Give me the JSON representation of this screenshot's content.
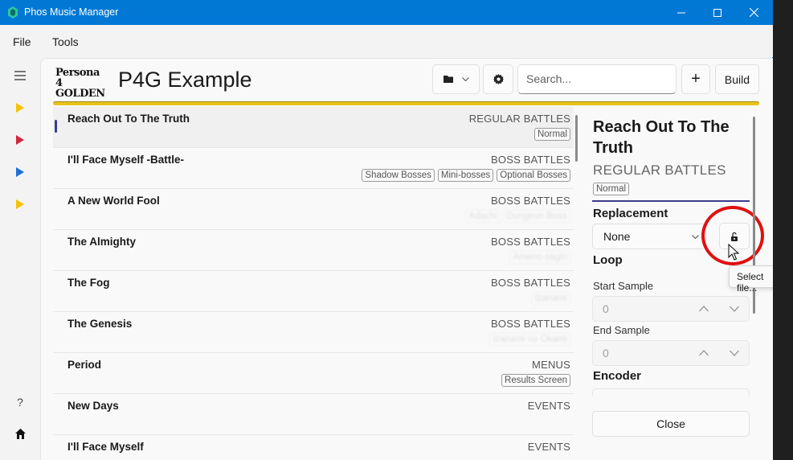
{
  "window": {
    "title": "Phos Music Manager",
    "minimize": "—",
    "maximize": "☐",
    "close": "✕"
  },
  "menu": {
    "file": "File",
    "tools": "Tools"
  },
  "rail": {
    "help": "?"
  },
  "header": {
    "logo_text_top": "Persona 4",
    "logo_text_bottom": "GOLDEN",
    "project_title": "P4G Example",
    "search_placeholder": "Search...",
    "add_label": "+",
    "build_label": "Build"
  },
  "tracks": [
    {
      "name": "Reach Out To The Truth",
      "category": "REGULAR BATTLES",
      "tags": [
        "Normal"
      ],
      "tags_visible": true,
      "selected": true
    },
    {
      "name": "I'll Face Myself -Battle-",
      "category": "BOSS BATTLES",
      "tags": [
        "Shadow Bosses",
        "Mini-bosses",
        "Optional Bosses"
      ],
      "tags_visible": true,
      "selected": false
    },
    {
      "name": "A New World Fool",
      "category": "BOSS BATTLES",
      "tags": [
        "Adachi",
        "Dungeon Boss"
      ],
      "tags_visible": false,
      "selected": false
    },
    {
      "name": "The Almighty",
      "category": "BOSS BATTLES",
      "tags": [
        "Ameno-sagiri"
      ],
      "tags_visible": false,
      "selected": false
    },
    {
      "name": "The Fog",
      "category": "BOSS BATTLES",
      "tags": [
        "Izanami"
      ],
      "tags_visible": false,
      "selected": false
    },
    {
      "name": "The Genesis",
      "category": "BOSS BATTLES",
      "tags": [
        "Izanami no Okami"
      ],
      "tags_visible": false,
      "selected": false
    },
    {
      "name": "Period",
      "category": "MENUS",
      "tags": [
        "Results Screen"
      ],
      "tags_visible": true,
      "selected": false
    },
    {
      "name": "New Days",
      "category": "EVENTS",
      "tags": [],
      "tags_visible": true,
      "selected": false
    },
    {
      "name": "I'll Face Myself",
      "category": "EVENTS",
      "tags": [],
      "tags_visible": true,
      "selected": false
    }
  ],
  "panel": {
    "title": "Reach Out To The Truth",
    "category": "REGULAR BATTLES",
    "tag": "Normal",
    "replacement_heading": "Replacement",
    "replacement_value": "None",
    "loop_heading": "Loop",
    "start_label": "Start Sample",
    "start_value": "0",
    "end_label": "End Sample",
    "end_value": "0",
    "encoder_heading": "Encoder",
    "close_label": "Close",
    "tooltip": "Select file..."
  },
  "colors": {
    "titlebar": "#0078d4",
    "gold": "#e8c21c",
    "accent": "#3c3c8c",
    "highlight_circle": "#e01010"
  },
  "rail_icons": [
    "menu-icon",
    "play-yellow-icon",
    "play-red-icon",
    "play-blue-icon",
    "play-yellow-icon",
    "help-icon",
    "home-icon"
  ]
}
